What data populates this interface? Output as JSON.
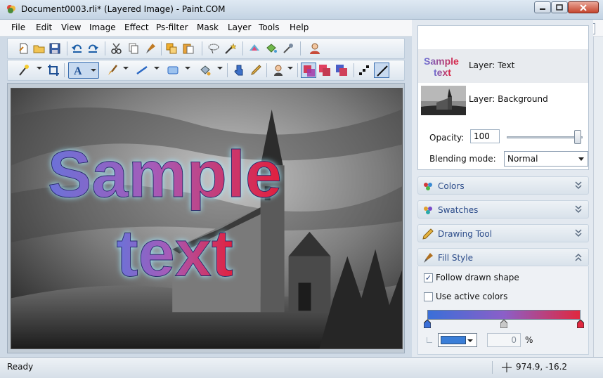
{
  "window": {
    "title": "Document0003.rli* (Layered Image) - Paint.COM",
    "minimize_icon": "minimize-icon",
    "maximize_icon": "maximize-icon",
    "close_icon": "close-icon"
  },
  "menu": {
    "items": [
      "File",
      "Edit",
      "View",
      "Image",
      "Effect",
      "Ps-filter",
      "Mask",
      "Layer",
      "Tools",
      "Help"
    ],
    "document_close": "×"
  },
  "canvas": {
    "overlay_text_line1": "Sample",
    "overlay_text_line2": "text"
  },
  "layers": {
    "items": [
      {
        "name": "Layer: Text",
        "thumb_line1": "Sample",
        "thumb_line2": "text",
        "selected": true
      },
      {
        "name": "Layer: Background",
        "selected": false
      }
    ],
    "opacity_label": "Opacity:",
    "opacity_value": "100",
    "blending_label": "Blending mode:",
    "blending_value": "Normal"
  },
  "sections": {
    "colors": "Colors",
    "swatches": "Swatches",
    "drawing_tool": "Drawing Tool",
    "fill_style": "Fill Style"
  },
  "fill_style": {
    "follow_label": "Follow drawn shape",
    "follow_checked": true,
    "active_label": "Use active colors",
    "active_checked": false,
    "percent_value": "0",
    "percent_sign": "%",
    "gradient_colors": [
      "#3a6fd8",
      "#8b5fc8",
      "#e0283f"
    ]
  },
  "status": {
    "text": "Ready",
    "coordinates": "974.9, -16.2"
  }
}
